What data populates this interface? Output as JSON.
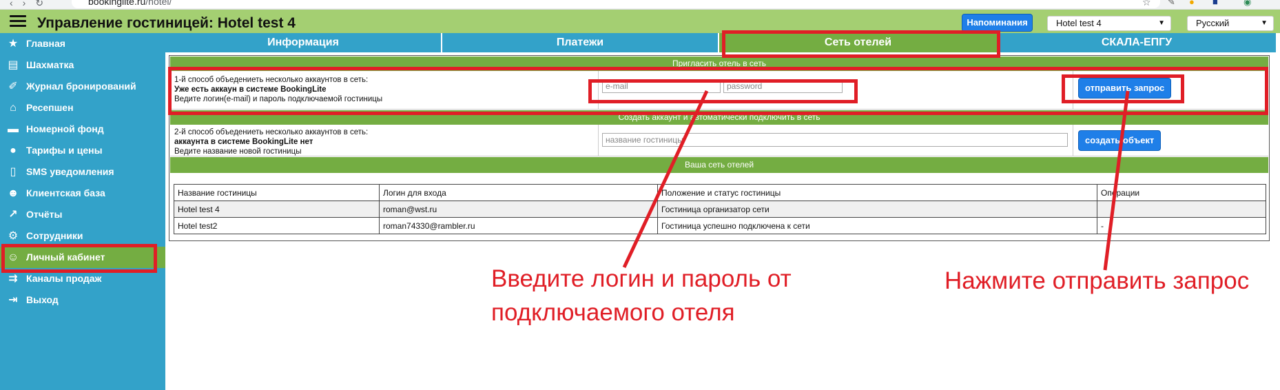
{
  "browser": {
    "url_domain": "bookinglite.ru",
    "url_path": "/hotel/"
  },
  "header": {
    "title": "Управление гостиницей: Hotel test 4",
    "reminders_button": "Напоминания",
    "hotel_select": "Hotel test 4",
    "language_select": "Русский"
  },
  "sidebar": {
    "items": [
      {
        "label": "Главная",
        "icon": "star-icon"
      },
      {
        "label": "Шахматка",
        "icon": "grid-icon"
      },
      {
        "label": "Журнал бронирований",
        "icon": "book-icon"
      },
      {
        "label": "Ресепшен",
        "icon": "reception-icon"
      },
      {
        "label": "Номерной фонд",
        "icon": "bed-icon"
      },
      {
        "label": "Тарифы и цены",
        "icon": "money-bag-icon"
      },
      {
        "label": "SMS уведомления",
        "icon": "phone-icon"
      },
      {
        "label": "Клиентская база",
        "icon": "face-icon"
      },
      {
        "label": "Отчёты",
        "icon": "chart-icon"
      },
      {
        "label": "Сотрудники",
        "icon": "gear-icon"
      },
      {
        "label": "Личный кабинет",
        "icon": "user-icon",
        "active": true
      },
      {
        "label": "Каналы продаж",
        "icon": "channels-icon"
      },
      {
        "label": "Выход",
        "icon": "exit-icon"
      }
    ]
  },
  "tabs": [
    {
      "label": "Информация"
    },
    {
      "label": "Платежи"
    },
    {
      "label": "Сеть отелей",
      "active": true
    },
    {
      "label": "СКАЛА-ЕПГУ"
    }
  ],
  "invite": {
    "header": "Пригласить отель в сеть",
    "line1": "1-й способ объедениеть несколько аккаунтов в сеть:",
    "line2": "Уже есть аккаун в системе BookingLite",
    "line3": "Ведите логин(e-mail) и пароль подключаемой гостиницы",
    "email_placeholder": "e-mail",
    "password_placeholder": "password",
    "send_button": "отправить запрос"
  },
  "create": {
    "header": "Создать аккаунт и автоматически подключить в сеть",
    "line1": "2-й способ объедениеть несколько аккаунтов в сеть:",
    "line2": "аккаунта в системе BookingLite нет",
    "line3": "Ведите название новой гостиницы",
    "name_placeholder": "название гостиницы",
    "create_button": "создать объект"
  },
  "network": {
    "header": "Ваша сеть отелей",
    "columns": [
      "Название гостиницы",
      "Логин для входа",
      "Положение и статус гостиницы",
      "Операции"
    ],
    "rows": [
      [
        "Hotel test 4",
        "roman@wst.ru",
        "Гостиница организатор сети",
        ""
      ],
      [
        "Hotel test2",
        "roman74330@rambler.ru",
        "Гостиница успешно подключена к сети",
        "-"
      ]
    ]
  },
  "annotations": {
    "left_line1": "Введите логин и пароль от",
    "left_line2": "подключаемого отеля",
    "right": "Нажмите отправить запрос"
  },
  "colors": {
    "accent_red": "#e01e26",
    "sidebar_blue": "#33a2c9",
    "green": "#74ad42",
    "header_green": "#a4cf72"
  }
}
